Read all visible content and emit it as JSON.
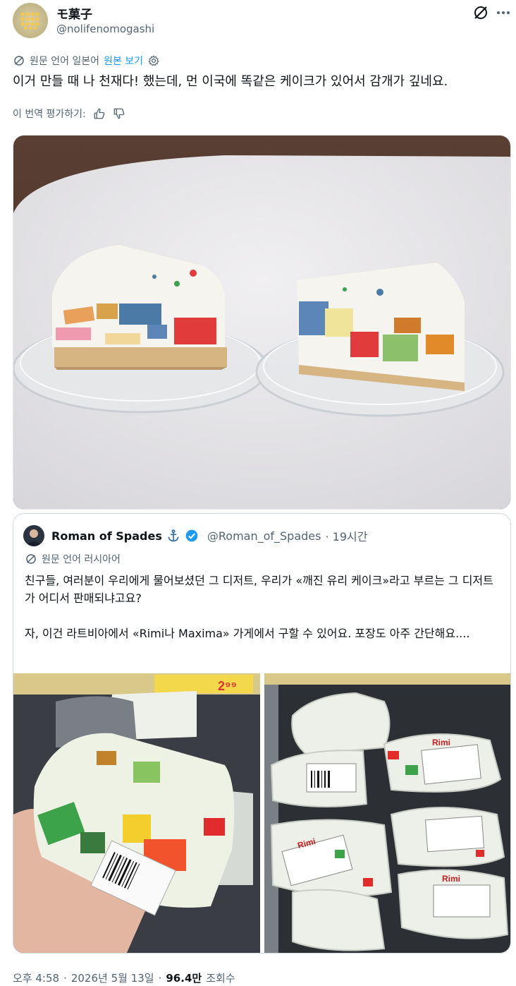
{
  "author": {
    "name": "モ菓子",
    "handle": "@nolifenomogashi"
  },
  "translation": {
    "source_label": "원문 언어 일본어",
    "view_original": "원본 보기",
    "rate_label": "이 번역 평가하기:"
  },
  "tweet": {
    "text": "이거 만들 때 나 천재다! 했는데, 먼 이국에 똑같은 케이크가 있어서 감개가 깊네요."
  },
  "media": {
    "description_icon": "cake-photo"
  },
  "quote": {
    "name": "Roman of Spades",
    "handle": "@Roman_of_Spades",
    "time": "· 19시간",
    "source_label": "원문 언어 러시아어",
    "text_1": "친구들, 여러분이 우리에게 물어보셨던 그 디저트, 우리가 «깨진 유리 케이크»라고 부르는 그 디저트가 어디서 판매되냐고요?",
    "text_2": "자, 이건 라트비아에서 «Rimi나 Maxima» 가게에서 구할 수 있어요. 포장도 아주 간단해요....",
    "label_brand": "Rimi"
  },
  "footer": {
    "time": "오후 4:58",
    "date": "2026년 5월 13일",
    "views": "96.4만",
    "views_label": "조회수"
  },
  "colors": {
    "link": "#1d9bf0",
    "muted": "#536471",
    "text": "#0f1419",
    "verified": "#1d9bf0"
  }
}
